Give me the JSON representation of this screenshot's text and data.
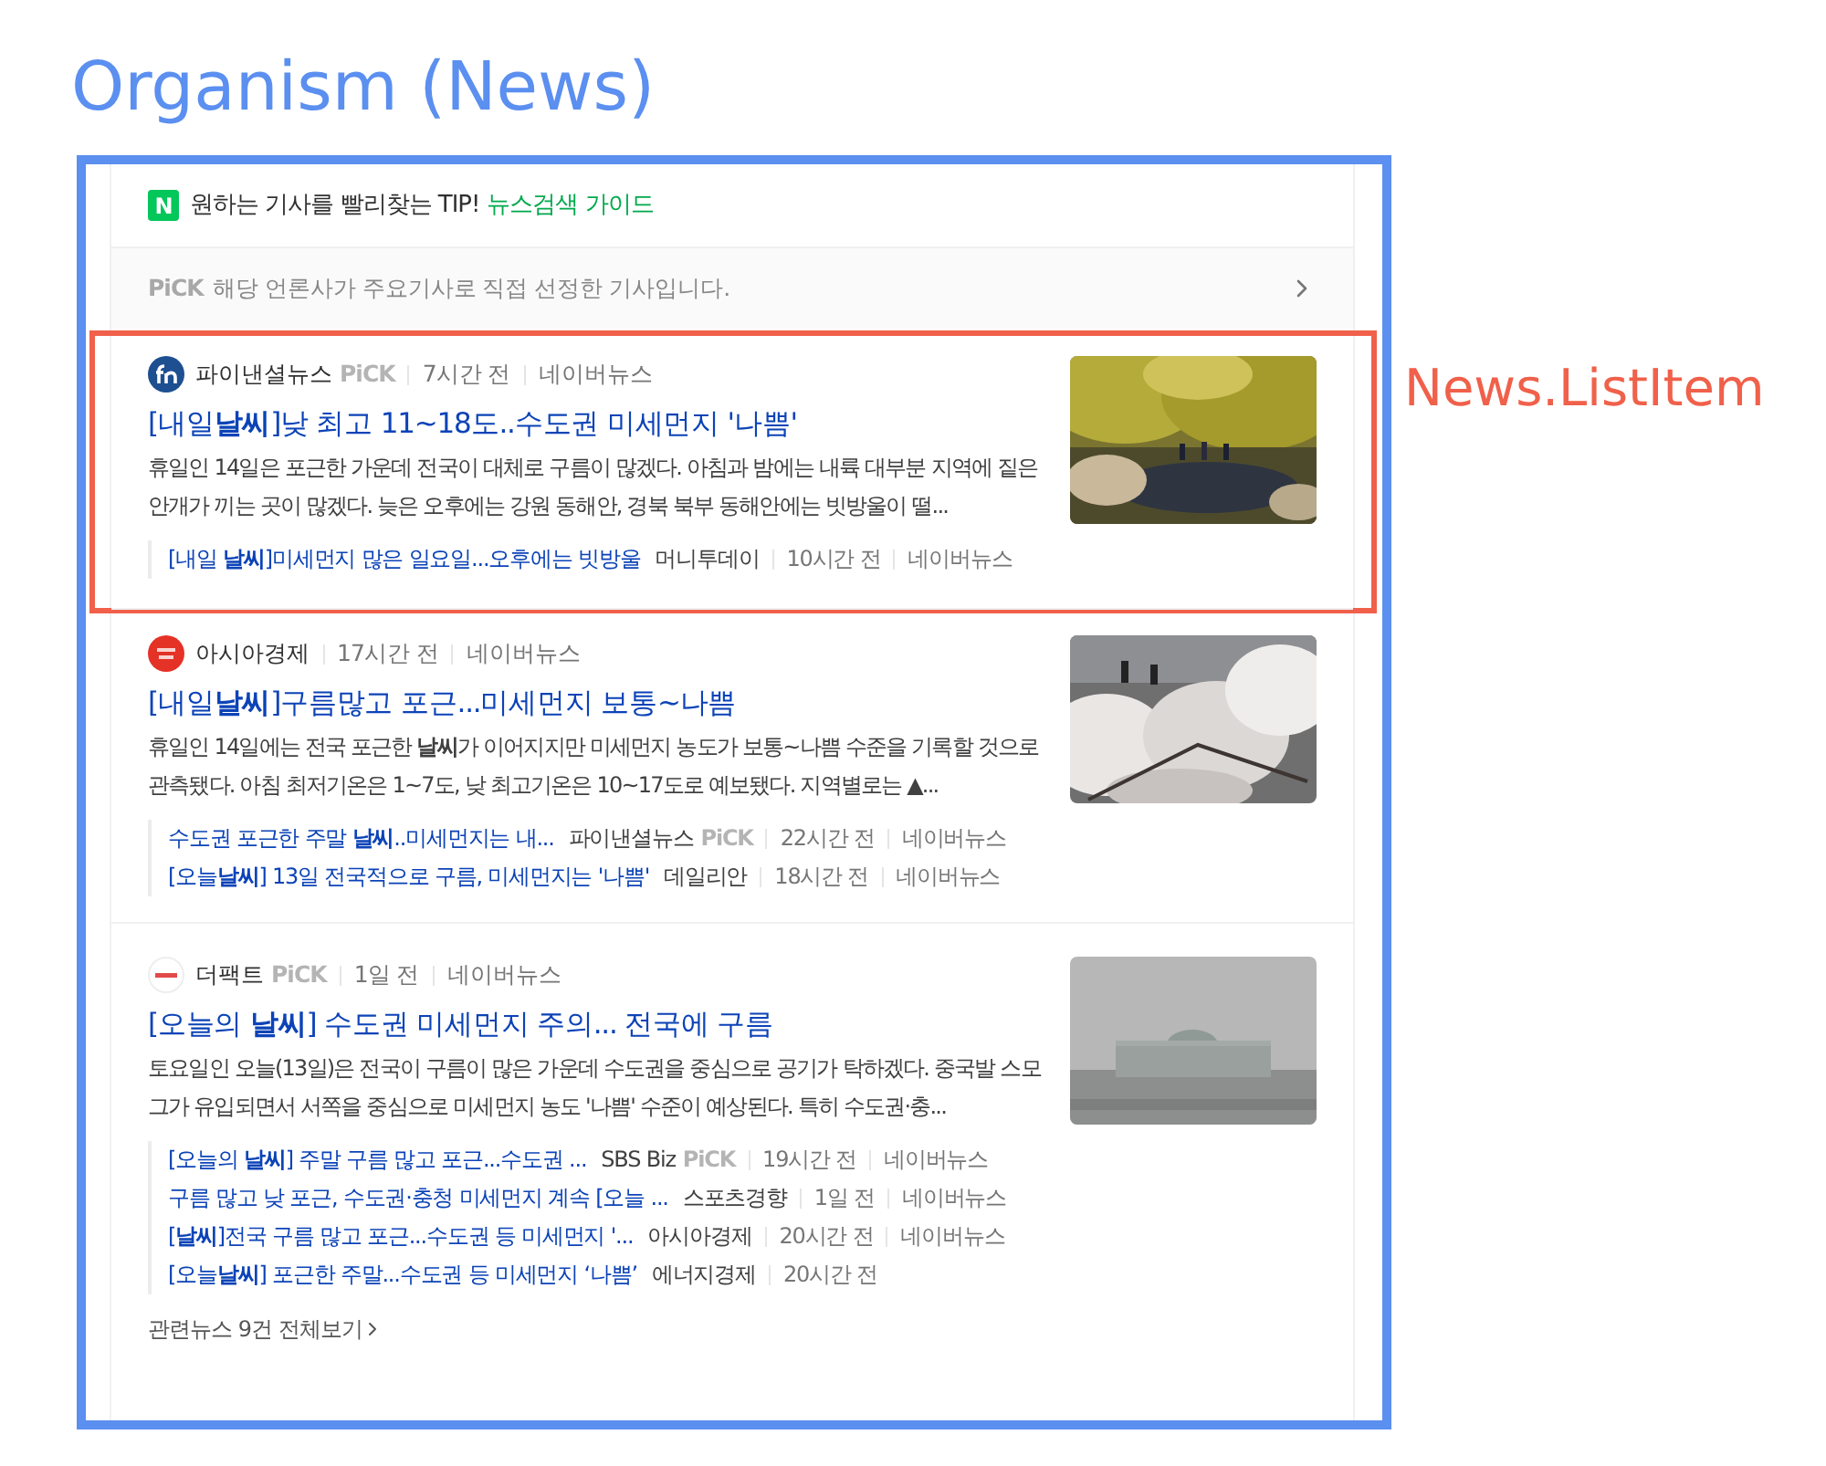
{
  "page_title": "Organism (News)",
  "annotation_label": "News.ListItem",
  "tip": {
    "logo_letter": "N",
    "text": "원하는 기사를 빨리찾는 TIP!",
    "link": "뉴스검색 가이드"
  },
  "pick_notice": {
    "badge": "PiCK",
    "text": "해당 언론사가 주요기사로 직접 선정한 기사입니다."
  },
  "items": [
    {
      "annotated": true,
      "press": "파이낸셜뉴스",
      "pick": "PiCK",
      "time": "7시간 전",
      "portal": "네이버뉴스",
      "title": "[내일**날씨**]낮 최고 11~18도..수도권 미세먼지 '나쁨'",
      "snippet": "휴일인 14일은 포근한 가운데 전국이 대체로 구름이 많겠다. 아침과 밤에는 내륙 대부분 지역에 짙은 안개가 끼는 곳이 많겠다. 늦은 오후에는 강원 동해안, 경북 북부 동해안에는 빗방울이 떨...",
      "related": [
        {
          "title": "[내일 **날씨**]미세먼지 많은 일요일...오후에는 빗방울",
          "press": "머니투데이",
          "time": "10시간 전",
          "portal": "네이버뉴스"
        }
      ]
    },
    {
      "annotated": false,
      "press": "아시아경제",
      "time": "17시간 전",
      "portal": "네이버뉴스",
      "title": "[내일**날씨**]구름많고 포근...미세먼지 보통~나쁨",
      "snippet": "휴일인 14일에는 전국 포근한 **날씨**가 이어지지만 미세먼지 농도가 보통~나쁨 수준을 기록할 것으로 관측됐다. 아침 최저기온은 1~7도, 낮 최고기온은 10~17도로 예보됐다. 지역별로는 ▲...",
      "related": [
        {
          "title": "수도권 포근한 주말 **날씨**..미세먼지는 내...",
          "press": "파이낸셜뉴스",
          "pick": "PiCK",
          "time": "22시간 전",
          "portal": "네이버뉴스"
        },
        {
          "title": "[오늘**날씨**] 13일 전국적으로 구름, 미세먼지는 '나쁨'",
          "press": "데일리안",
          "time": "18시간 전",
          "portal": "네이버뉴스"
        }
      ]
    },
    {
      "annotated": false,
      "press": "더팩트",
      "pick": "PiCK",
      "time": "1일 전",
      "portal": "네이버뉴스",
      "title": "[오늘의 **날씨**] 수도권 미세먼지 주의... 전국에 구름",
      "snippet": "토요일인 오늘(13일)은 전국이 구름이 많은 가운데 수도권을 중심으로 공기가 탁하겠다. 중국발 스모그가 유입되면서 서쪽을 중심으로 미세먼지 농도 '나쁨' 수준이 예상된다. 특히 수도권·충...",
      "related": [
        {
          "title": "[오늘의 **날씨**] 주말 구름 많고 포근...수도권 ...",
          "press": "SBS Biz",
          "pick": "PiCK",
          "time": "19시간 전",
          "portal": "네이버뉴스"
        },
        {
          "title": "구름 많고 낮 포근, 수도권·충청 미세먼지 계속 [오늘 ...",
          "press": "스포츠경향",
          "time": "1일 전",
          "portal": "네이버뉴스"
        },
        {
          "title": "[**날씨**]전국 구름 많고 포근...수도권 등 미세먼지 '...",
          "press": "아시아경제",
          "time": "20시간 전",
          "portal": "네이버뉴스"
        },
        {
          "title": "[오늘**날씨**] 포근한 주말...수도권 등 미세먼지 ‘나쁨’",
          "press": "에너지경제",
          "time": "20시간 전"
        }
      ],
      "more": "관련뉴스 9건 전체보기"
    }
  ]
}
